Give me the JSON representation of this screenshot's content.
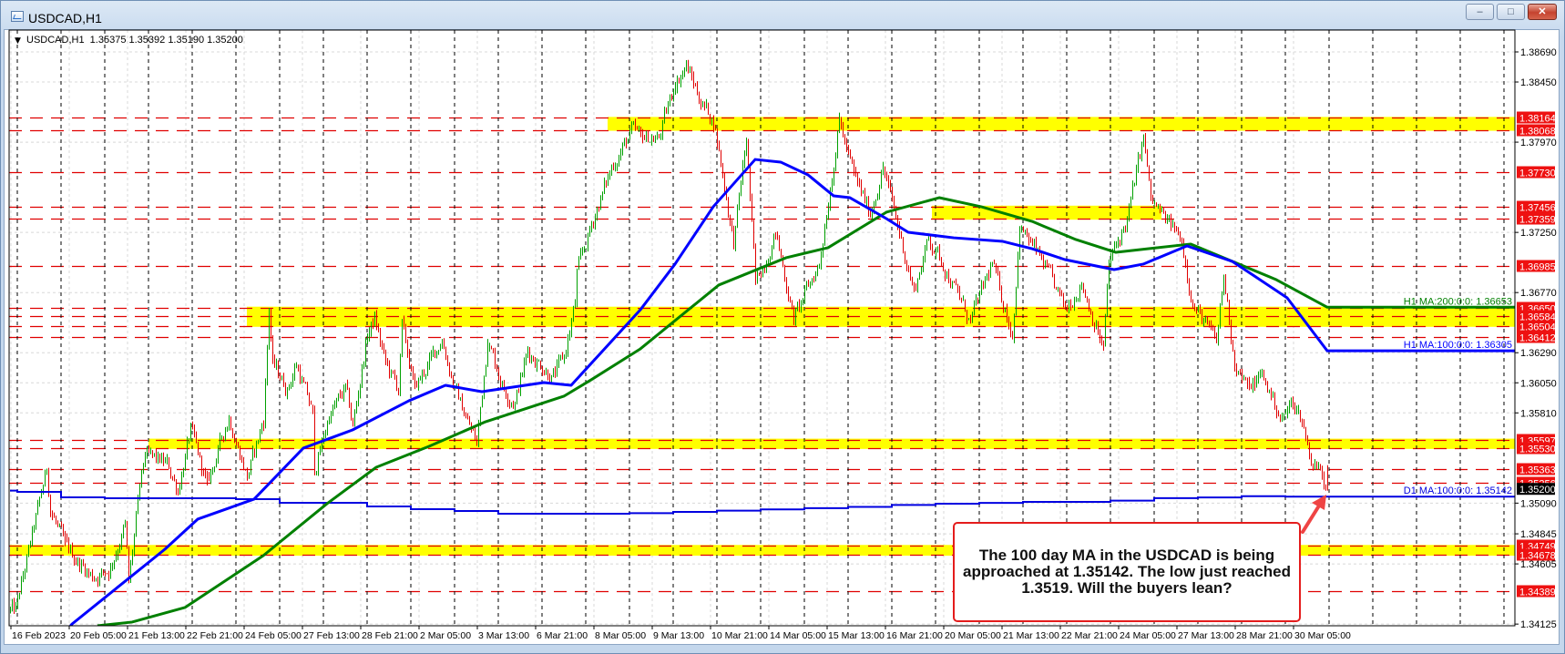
{
  "window": {
    "title": "USDCAD,H1",
    "buttons": {
      "minimize": "–",
      "restore": "□",
      "close": "✕"
    }
  },
  "chart_header": {
    "collapse_icon": "▼",
    "text": "USDCAD,H1  1.35375 1.35392 1.35190 1.35200"
  },
  "annotation": {
    "lines": [
      "The 100 day MA in the USDCAD is being",
      "approached at 1.35142. The low just reached",
      "1.3519.  Will the buyers lean?"
    ]
  },
  "colors": {
    "bull": "#00a000",
    "bear": "#e00000",
    "ma_h1_200": "#008000",
    "ma_h1_100": "#0000ff",
    "ma_d1_100": "#0000e0",
    "level_line": "#e00000",
    "zone": "#ffff00",
    "level_label_bg": "#ee1111",
    "current_price_bg": "#000000",
    "annotation_border": "#e41c1c"
  },
  "chart_data": {
    "type": "candlestick",
    "title": "USDCAD,H1",
    "ohlc_last": {
      "open": 1.35375,
      "high": 1.35392,
      "low": 1.3519,
      "close": 1.352
    },
    "ylim": [
      1.34125,
      1.38864
    ],
    "y_tick_labels": [
      "1.38690",
      "1.38450",
      "1.37970",
      "1.37250",
      "1.36770",
      "1.36290",
      "1.36050",
      "1.35810",
      "1.35090",
      "1.34845",
      "1.34605",
      "1.34125"
    ],
    "x_tick_labels": [
      "16 Feb 2023",
      "20 Feb 05:00",
      "21 Feb 13:00",
      "22 Feb 21:00",
      "24 Feb 05:00",
      "27 Feb 13:00",
      "28 Feb 21:00",
      "2 Mar 05:00",
      "3 Mar 13:00",
      "6 Mar 21:00",
      "8 Mar 05:00",
      "9 Mar 13:00",
      "10 Mar 21:00",
      "14 Mar 05:00",
      "15 Mar 13:00",
      "16 Mar 21:00",
      "20 Mar 05:00",
      "21 Mar 13:00",
      "22 Mar 21:00",
      "24 Mar 05:00",
      "27 Mar 13:00",
      "28 Mar 21:00",
      "30 Mar 05:00"
    ],
    "bars_per_x_label": 32,
    "bars_per_day": 24,
    "price_keypoints": [
      [
        3,
        1.34235
      ],
      [
        20,
        1.35362
      ],
      [
        22,
        1.3505
      ],
      [
        30,
        1.34744
      ],
      [
        45,
        1.34504
      ],
      [
        54,
        1.3455
      ],
      [
        63,
        1.34911
      ],
      [
        65,
        1.3445
      ],
      [
        71,
        1.352
      ],
      [
        74,
        1.35471
      ],
      [
        86,
        1.354
      ],
      [
        92,
        1.352
      ],
      [
        99,
        1.35667
      ],
      [
        108,
        1.35231
      ],
      [
        120,
        1.35783
      ],
      [
        130,
        1.353
      ],
      [
        139,
        1.3575
      ],
      [
        142,
        1.36648
      ],
      [
        144,
        1.362
      ],
      [
        152,
        1.36001
      ],
      [
        157,
        1.362
      ],
      [
        166,
        1.358
      ],
      [
        167,
        1.35347
      ],
      [
        175,
        1.35783
      ],
      [
        184,
        1.36
      ],
      [
        188,
        1.357
      ],
      [
        196,
        1.36437
      ],
      [
        200,
        1.36561
      ],
      [
        206,
        1.362
      ],
      [
        213,
        1.36
      ],
      [
        215,
        1.365
      ],
      [
        222,
        1.36
      ],
      [
        237,
        1.364
      ],
      [
        244,
        1.36
      ],
      [
        256,
        1.35565
      ],
      [
        262,
        1.364
      ],
      [
        271,
        1.36
      ],
      [
        277,
        1.359
      ],
      [
        284,
        1.363
      ],
      [
        298,
        1.361
      ],
      [
        304,
        1.3625
      ],
      [
        310,
        1.36684
      ],
      [
        311,
        1.3692
      ],
      [
        321,
        1.374
      ],
      [
        331,
        1.378
      ],
      [
        341,
        1.3805
      ],
      [
        346,
        1.3801
      ],
      [
        356,
        1.38
      ],
      [
        365,
        1.3845
      ],
      [
        371,
        1.3858
      ],
      [
        379,
        1.383
      ],
      [
        386,
        1.38138
      ],
      [
        389,
        1.379
      ],
      [
        397,
        1.37164
      ],
      [
        404,
        1.37992
      ],
      [
        409,
        1.3683
      ],
      [
        420,
        1.3725
      ],
      [
        430,
        1.36561
      ],
      [
        444,
        1.37
      ],
      [
        455,
        1.38138
      ],
      [
        463,
        1.377
      ],
      [
        472,
        1.374
      ],
      [
        479,
        1.37774
      ],
      [
        496,
        1.36779
      ],
      [
        504,
        1.372
      ],
      [
        512,
        1.37
      ],
      [
        527,
        1.36539
      ],
      [
        539,
        1.37
      ],
      [
        550,
        1.36437
      ],
      [
        554,
        1.373
      ],
      [
        567,
        1.37
      ],
      [
        579,
        1.36633
      ],
      [
        588,
        1.3685
      ],
      [
        600,
        1.36321
      ],
      [
        603,
        1.37
      ],
      [
        613,
        1.3735
      ],
      [
        622,
        1.38014
      ],
      [
        626,
        1.375
      ],
      [
        634,
        1.3735
      ],
      [
        643,
        1.372
      ],
      [
        649,
        1.36684
      ],
      [
        662,
        1.36365
      ],
      [
        666,
        1.369
      ],
      [
        672,
        1.3622
      ],
      [
        679,
        1.36
      ],
      [
        687,
        1.3611
      ],
      [
        698,
        1.35756
      ],
      [
        704,
        1.359
      ],
      [
        709,
        1.3575
      ],
      [
        714,
        1.35436
      ],
      [
        719,
        1.3535
      ],
      [
        723,
        1.352
      ]
    ],
    "ma_h1_200": {
      "label": "H1 MA:200:0:0: 1.36653",
      "value": 1.36653,
      "points": [
        [
          48,
          1.34112
        ],
        [
          67,
          1.34141
        ],
        [
          96,
          1.34257
        ],
        [
          139,
          1.34671
        ],
        [
          174,
          1.35086
        ],
        [
          201,
          1.35376
        ],
        [
          230,
          1.35543
        ],
        [
          261,
          1.35739
        ],
        [
          304,
          1.35943
        ],
        [
          319,
          1.36074
        ],
        [
          346,
          1.36321
        ],
        [
          389,
          1.3683
        ],
        [
          426,
          1.37048
        ],
        [
          449,
          1.37128
        ],
        [
          481,
          1.37411
        ],
        [
          510,
          1.37527
        ],
        [
          533,
          1.37455
        ],
        [
          561,
          1.37338
        ],
        [
          585,
          1.37193
        ],
        [
          607,
          1.37091
        ],
        [
          648,
          1.37157
        ],
        [
          671,
          1.37018
        ],
        [
          695,
          1.36873
        ],
        [
          723,
          1.36653
        ]
      ]
    },
    "ma_h1_100": {
      "label": "H1 MA:100:0:0: 1.36305",
      "value": 1.36305,
      "points": [
        [
          30,
          1.3405
        ],
        [
          34,
          1.34125
        ],
        [
          85,
          1.34722
        ],
        [
          103,
          1.34962
        ],
        [
          134,
          1.35122
        ],
        [
          161,
          1.35529
        ],
        [
          188,
          1.35674
        ],
        [
          219,
          1.35907
        ],
        [
          239,
          1.3603
        ],
        [
          259,
          1.35979
        ],
        [
          293,
          1.36052
        ],
        [
          308,
          1.3603
        ],
        [
          346,
          1.36633
        ],
        [
          365,
          1.36997
        ],
        [
          386,
          1.37455
        ],
        [
          409,
          1.37832
        ],
        [
          423,
          1.37811
        ],
        [
          438,
          1.37709
        ],
        [
          452,
          1.37542
        ],
        [
          461,
          1.37527
        ],
        [
          481,
          1.3736
        ],
        [
          493,
          1.37251
        ],
        [
          518,
          1.37207
        ],
        [
          545,
          1.37178
        ],
        [
          561,
          1.3712
        ],
        [
          579,
          1.37033
        ],
        [
          606,
          1.36953
        ],
        [
          622,
          1.36997
        ],
        [
          646,
          1.37142
        ],
        [
          671,
          1.37018
        ],
        [
          683,
          1.36902
        ],
        [
          701,
          1.36728
        ],
        [
          723,
          1.36305
        ]
      ]
    },
    "ma_d1_100": {
      "label": "D1 MA:100:0:0: 1.35142",
      "value": 1.35142,
      "daily_values": [
        1.3519,
        1.3518,
        1.35136,
        1.35129,
        1.35129,
        1.35129,
        1.35122,
        1.35093,
        1.35093,
        1.35064,
        1.35042,
        1.35027,
        1.35005,
        1.35005,
        1.35005,
        1.3501,
        1.3502,
        1.3503,
        1.3504,
        1.3505,
        1.3506,
        1.35075,
        1.35085,
        1.35092,
        1.351,
        1.351,
        1.3511,
        1.3513,
        1.35135,
        1.35145,
        1.35142
      ]
    },
    "levels": [
      "1.38164",
      "1.38068",
      "1.37730",
      "1.37456",
      "1.37359",
      "1.36985",
      "1.36650",
      "1.36584",
      "1.36504",
      "1.36412",
      "1.35597",
      "1.35530",
      "1.35363",
      "1.35256",
      "1.34749",
      "1.34678",
      "1.34389"
    ],
    "zones": [
      {
        "low": 1.38068,
        "high": 1.38164,
        "start_bar": 328,
        "end_bar": null
      },
      {
        "low": 1.37359,
        "high": 1.37456,
        "start_bar": 506,
        "end_bar": 632
      },
      {
        "low": 1.36504,
        "high": 1.3665,
        "start_bar": 130,
        "end_bar": null
      },
      {
        "low": 1.3553,
        "high": 1.35597,
        "start_bar": 76,
        "end_bar": null
      },
      {
        "low": 1.34678,
        "high": 1.34749,
        "start_bar": 0,
        "end_bar": null
      }
    ],
    "current_price": "1.35200",
    "grid": true
  }
}
